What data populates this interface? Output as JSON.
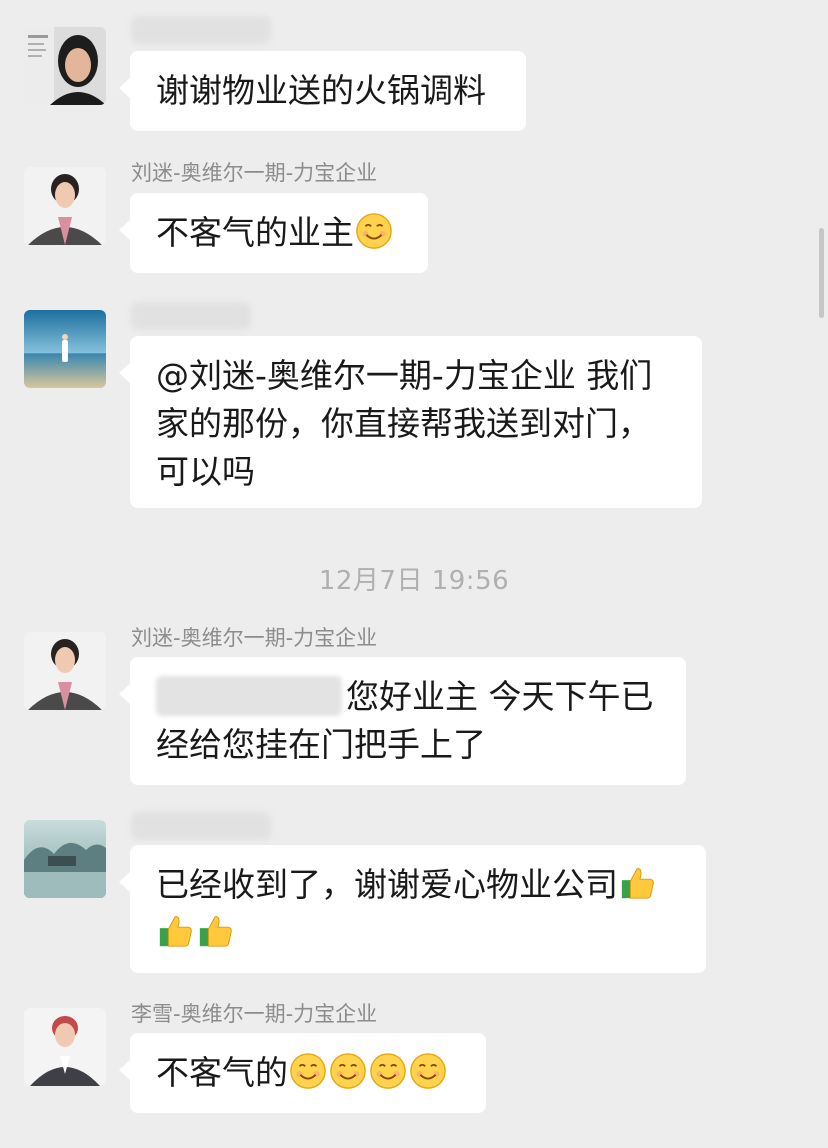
{
  "messages": [
    {
      "sender": "",
      "text": "谢谢物业送的火锅调料",
      "emoji": []
    },
    {
      "sender": "刘迷-奥维尔一期-力宝企业",
      "text": "不客气的业主",
      "emoji": [
        "smile-emoji"
      ]
    },
    {
      "sender": "",
      "text": "@刘迷-奥维尔一期-力宝企业 我们\n家的那份，你直接帮我送到对门，\n可以吗",
      "emoji": []
    },
    {
      "sender": "刘迷-奥维尔一期-力宝企业",
      "text_a": "您好业主 今天下午已",
      "text_b": "经给您挂在门把手上了",
      "emoji": []
    },
    {
      "sender": "",
      "text_a": "已经收到了，谢谢爱心物业公司",
      "emoji": [
        "thumbs-up-emoji",
        "thumbs-up-emoji",
        "thumbs-up-emoji"
      ]
    },
    {
      "sender": "李雪-奥维尔一期-力宝企业",
      "text": "不客气的",
      "emoji": [
        "smile-emoji",
        "smile-emoji",
        "smile-emoji",
        "smile-emoji"
      ]
    }
  ],
  "timestamp": "12月7日 19:56",
  "colors": {
    "background": "#ededed",
    "bubble": "#ffffff",
    "name": "#8c8c8c",
    "timestamp": "#b0b0b0"
  }
}
